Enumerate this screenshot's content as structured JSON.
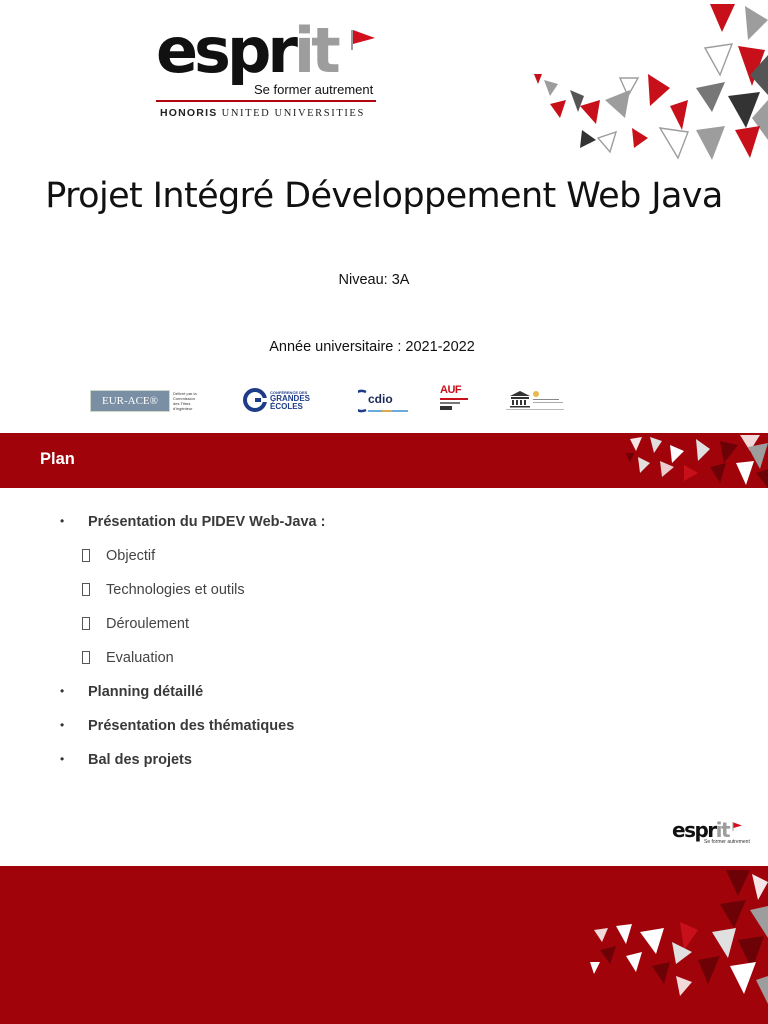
{
  "logo": {
    "wordmark_main": "espr",
    "wordmark_accent": "it",
    "tagline": "Se former autrement",
    "university_bold": "HONORIS",
    "university_rest": " UNITED UNIVERSITIES"
  },
  "title": "Projet Intégré Développement Web Java",
  "level": "Niveau: 3A",
  "academic_year": "Année universitaire : 2021-2022",
  "accreditations": [
    {
      "name": "EUR-ACE",
      "label": "EUR-ACE®",
      "caption_lines": [
        "Délivré par la",
        "Commission",
        "des Titres",
        "d'ingénieur"
      ]
    },
    {
      "name": "CGE",
      "caption_lines": [
        "CONFÉRENCE DES",
        "GRANDES",
        "ÉCOLES"
      ]
    },
    {
      "name": "CDIO",
      "label": "cdio"
    },
    {
      "name": "AUF",
      "label": "AUF"
    },
    {
      "name": "UNESCO"
    }
  ],
  "section": {
    "title": "Plan"
  },
  "plan": [
    {
      "level": 1,
      "text": "Présentation du PIDEV Web-Java :"
    },
    {
      "level": 2,
      "text": "Objectif"
    },
    {
      "level": 2,
      "text": "Technologies et outils"
    },
    {
      "level": 2,
      "text": "Déroulement"
    },
    {
      "level": 2,
      "text": "Evaluation"
    },
    {
      "level": 1,
      "text": "Planning détaillé"
    },
    {
      "level": 1,
      "text": "Présentation des thématiques"
    },
    {
      "level": 1,
      "text": "Bal des projets"
    }
  ],
  "footer_logo": {
    "wordmark_main": "espr",
    "wordmark_accent": "it",
    "tagline": "Se former autrement"
  },
  "colors": {
    "brand_red": "#a1030a",
    "accent_red": "#c8101a",
    "gray": "#9d9d9d",
    "dark_gray": "#555555"
  },
  "bullets": {
    "level1": "•",
    "level2": "box"
  }
}
